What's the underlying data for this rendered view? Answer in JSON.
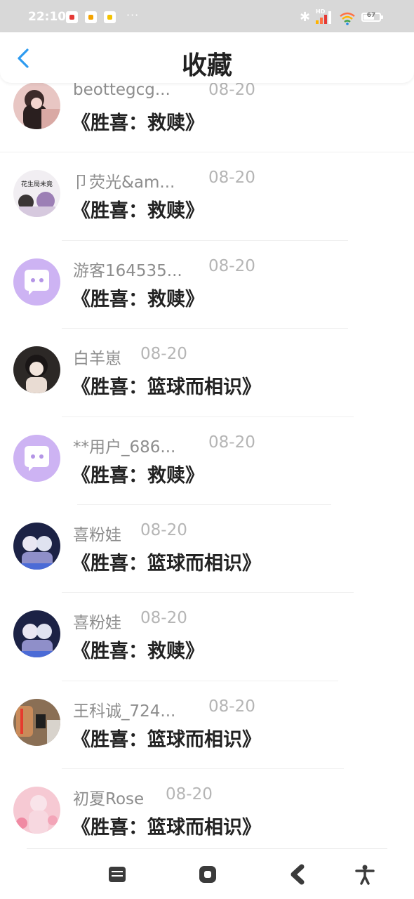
{
  "status_bar": {
    "time": "22:10",
    "more": "···",
    "battery_level": "67",
    "network_label": "HD"
  },
  "header": {
    "title": "收藏"
  },
  "favorites": [
    {
      "user": "beottegcg...",
      "date": "08-20",
      "title": "《胜喜：救赎》",
      "avatar": "photo"
    },
    {
      "user": "卩荧光&am...",
      "date": "08-20",
      "title": "《胜喜：救赎》",
      "avatar": "photo"
    },
    {
      "user": "游客164535...",
      "date": "08-20",
      "title": "《胜喜：救赎》",
      "avatar": "default-chat"
    },
    {
      "user": "白羊崽",
      "date": "08-20",
      "title": "《胜喜：篮球而相识》",
      "avatar": "photo"
    },
    {
      "user": "**用户_686...",
      "date": "08-20",
      "title": "《胜喜：救赎》",
      "avatar": "default-chat"
    },
    {
      "user": "喜粉娃",
      "date": "08-20",
      "title": "《胜喜：篮球而相识》",
      "avatar": "photo"
    },
    {
      "user": "喜粉娃",
      "date": "08-20",
      "title": "《胜喜：救赎》",
      "avatar": "photo"
    },
    {
      "user": "王科诚_724...",
      "date": "08-20",
      "title": "《胜喜：篮球而相识》",
      "avatar": "photo"
    },
    {
      "user": "初夏Rose",
      "date": "08-20",
      "title": "《胜喜：篮球而相识》",
      "avatar": "photo"
    }
  ],
  "avatar_text": {
    "1": "花生局未竟"
  },
  "colors": {
    "accent": "#2e9bf0",
    "default_avatar": "#cdb3f3",
    "nav_icon": "#3b3b3b"
  }
}
